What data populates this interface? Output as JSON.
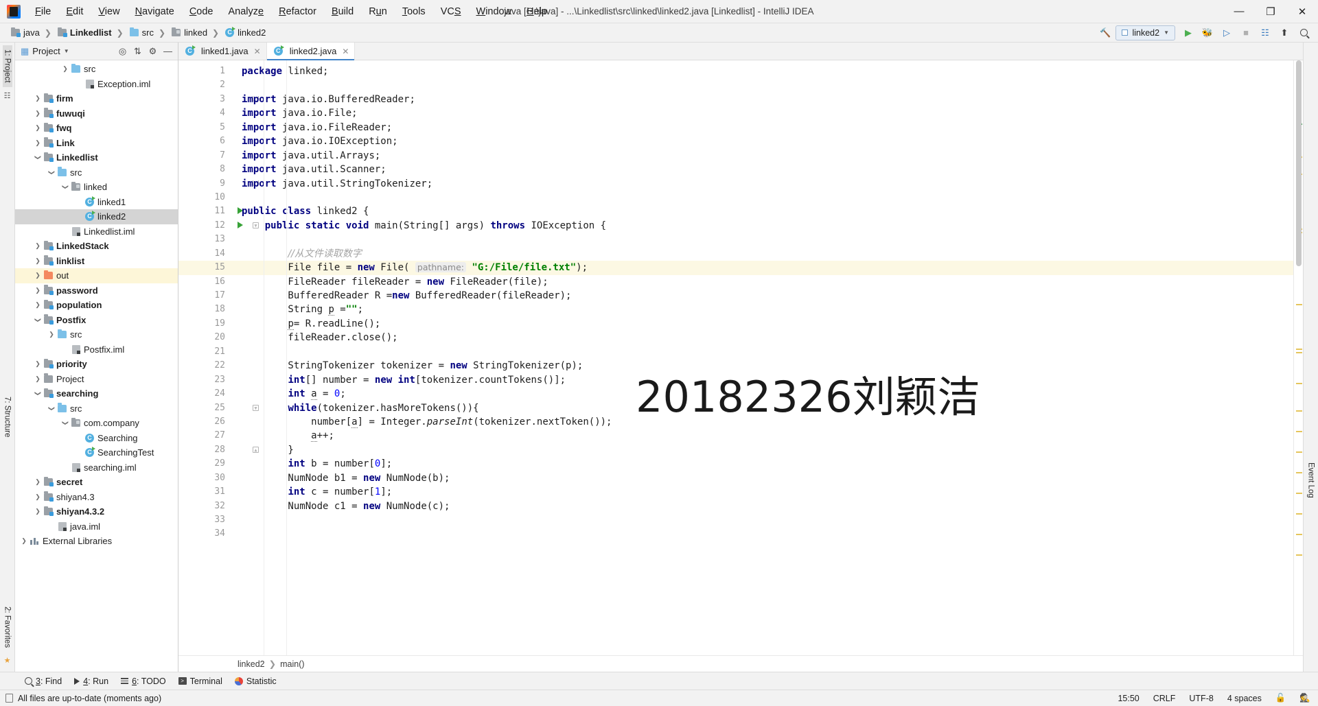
{
  "window": {
    "title": "java [G:\\java] - ...\\Linkedlist\\src\\linked\\linked2.java [Linkedlist] - IntelliJ IDEA",
    "minimize": "—",
    "maximize": "❐",
    "close": "✕"
  },
  "menubar": [
    {
      "label": "File"
    },
    {
      "label": "Edit"
    },
    {
      "label": "View"
    },
    {
      "label": "Navigate"
    },
    {
      "label": "Code"
    },
    {
      "label": "Analyze"
    },
    {
      "label": "Refactor"
    },
    {
      "label": "Build"
    },
    {
      "label": "Run"
    },
    {
      "label": "Tools"
    },
    {
      "label": "VCS"
    },
    {
      "label": "Window"
    },
    {
      "label": "Help"
    }
  ],
  "breadcrumbs": [
    {
      "label": "java",
      "icon": "folder-module-icon",
      "bold": false
    },
    {
      "label": "Linkedlist",
      "icon": "folder-module-icon",
      "bold": true
    },
    {
      "label": "src",
      "icon": "folder-source-icon",
      "bold": false
    },
    {
      "label": "linked",
      "icon": "folder-package-icon",
      "bold": false
    },
    {
      "label": "linked2",
      "icon": "java-class-icon",
      "bold": false
    }
  ],
  "toolbar_right": {
    "build_icon": "hammer-icon",
    "run_config": "linked2",
    "run_icon": "run-icon",
    "debug_icon": "debug-icon",
    "coverage_icon": "run-coverage-icon",
    "stop_icon": "stop-icon",
    "layout_icon": "layout-icon",
    "updates_icon": "updates-icon",
    "search_icon": "search-everywhere-icon"
  },
  "project_panel": {
    "title": "Project",
    "icons": [
      "target-icon",
      "collapse-all-icon",
      "settings-gear-icon",
      "hide-icon"
    ],
    "tree": [
      {
        "label": "src",
        "indent": 3,
        "arrow": "right",
        "icon": "folder-source-icon",
        "bold": false
      },
      {
        "label": "Exception.iml",
        "indent": 4,
        "arrow": "none",
        "icon": "iml-file-icon",
        "bold": false
      },
      {
        "label": "firm",
        "indent": 1,
        "arrow": "right",
        "icon": "folder-module-icon",
        "bold": true
      },
      {
        "label": "fuwuqi",
        "indent": 1,
        "arrow": "right",
        "icon": "folder-module-icon",
        "bold": true
      },
      {
        "label": "fwq",
        "indent": 1,
        "arrow": "right",
        "icon": "folder-module-icon",
        "bold": true
      },
      {
        "label": "Link",
        "indent": 1,
        "arrow": "right",
        "icon": "folder-module-icon",
        "bold": true
      },
      {
        "label": "Linkedlist",
        "indent": 1,
        "arrow": "down",
        "icon": "folder-module-icon",
        "bold": true
      },
      {
        "label": "src",
        "indent": 2,
        "arrow": "down",
        "icon": "folder-source-icon",
        "bold": false
      },
      {
        "label": "linked",
        "indent": 3,
        "arrow": "down",
        "icon": "folder-package-icon",
        "bold": false
      },
      {
        "label": "linked1",
        "indent": 4,
        "arrow": "none",
        "icon": "java-class-run-icon",
        "bold": false
      },
      {
        "label": "linked2",
        "indent": 4,
        "arrow": "none",
        "icon": "java-class-run-icon",
        "bold": false,
        "selected": true
      },
      {
        "label": "Linkedlist.iml",
        "indent": 3,
        "arrow": "none",
        "icon": "iml-file-icon",
        "bold": false
      },
      {
        "label": "LinkedStack",
        "indent": 1,
        "arrow": "right",
        "icon": "folder-module-icon",
        "bold": true
      },
      {
        "label": "linklist",
        "indent": 1,
        "arrow": "right",
        "icon": "folder-module-icon",
        "bold": true
      },
      {
        "label": "out",
        "indent": 1,
        "arrow": "right",
        "icon": "folder-excluded-icon",
        "bold": false,
        "highlight": true
      },
      {
        "label": "password",
        "indent": 1,
        "arrow": "right",
        "icon": "folder-module-icon",
        "bold": true
      },
      {
        "label": "population",
        "indent": 1,
        "arrow": "right",
        "icon": "folder-module-icon",
        "bold": true
      },
      {
        "label": "Postfix",
        "indent": 1,
        "arrow": "down",
        "icon": "folder-module-icon",
        "bold": true
      },
      {
        "label": "src",
        "indent": 2,
        "arrow": "right",
        "icon": "folder-source-icon",
        "bold": false
      },
      {
        "label": "Postfix.iml",
        "indent": 3,
        "arrow": "none",
        "icon": "iml-file-icon",
        "bold": false
      },
      {
        "label": "priority",
        "indent": 1,
        "arrow": "right",
        "icon": "folder-module-icon",
        "bold": true
      },
      {
        "label": "Project",
        "indent": 1,
        "arrow": "right",
        "icon": "folder-plain-icon",
        "bold": false
      },
      {
        "label": "searching",
        "indent": 1,
        "arrow": "down",
        "icon": "folder-module-icon",
        "bold": true
      },
      {
        "label": "src",
        "indent": 2,
        "arrow": "down",
        "icon": "folder-source-icon",
        "bold": false
      },
      {
        "label": "com.company",
        "indent": 3,
        "arrow": "down",
        "icon": "folder-package-icon",
        "bold": false
      },
      {
        "label": "Searching",
        "indent": 4,
        "arrow": "none",
        "icon": "java-class-icon",
        "bold": false
      },
      {
        "label": "SearchingTest",
        "indent": 4,
        "arrow": "none",
        "icon": "java-class-run-icon",
        "bold": false
      },
      {
        "label": "searching.iml",
        "indent": 3,
        "arrow": "none",
        "icon": "iml-file-icon",
        "bold": false
      },
      {
        "label": "secret",
        "indent": 1,
        "arrow": "right",
        "icon": "folder-module-icon",
        "bold": true
      },
      {
        "label": "shiyan4.3",
        "indent": 1,
        "arrow": "right",
        "icon": "folder-module-icon",
        "bold": false
      },
      {
        "label": "shiyan4.3.2",
        "indent": 1,
        "arrow": "right",
        "icon": "folder-module-icon",
        "bold": true
      },
      {
        "label": "java.iml",
        "indent": 2,
        "arrow": "none",
        "icon": "iml-file-icon",
        "bold": false
      },
      {
        "label": "External Libraries",
        "indent": 0,
        "arrow": "right",
        "icon": "library-icon",
        "bold": false
      }
    ]
  },
  "left_rail": {
    "project_label": "1: Project",
    "structure_label": "7: Structure",
    "favorites_label": "2: Favorites"
  },
  "right_rail": {
    "event_log_label": "Event Log"
  },
  "editor": {
    "tabs": [
      {
        "label": "linked1.java",
        "icon": "java-class-run-icon",
        "active": false
      },
      {
        "label": "linked2.java",
        "icon": "java-class-run-icon",
        "active": true
      }
    ],
    "watermark": "20182326刘颖洁",
    "breadcrumb": [
      "linked2",
      "main()"
    ],
    "lines": [
      {
        "n": 1,
        "run": false,
        "fold": "",
        "html": "<span class='kw'>package</span> linked;"
      },
      {
        "n": 2,
        "run": false,
        "fold": "",
        "html": ""
      },
      {
        "n": 3,
        "run": false,
        "fold": "top",
        "html": "<span class='kw'>import</span> java.io.BufferedReader;"
      },
      {
        "n": 4,
        "run": false,
        "fold": "",
        "html": "<span class='kw'>import</span> java.io.File;"
      },
      {
        "n": 5,
        "run": false,
        "fold": "",
        "html": "<span class='kw'>import</span> java.io.FileReader;"
      },
      {
        "n": 6,
        "run": false,
        "fold": "",
        "html": "<span class='kw'>import</span> java.io.IOException;"
      },
      {
        "n": 7,
        "run": false,
        "fold": "",
        "html": "<span class='kw'>import</span> java.util.Arrays;"
      },
      {
        "n": 8,
        "run": false,
        "fold": "",
        "html": "<span class='kw'>import</span> java.util.Scanner;"
      },
      {
        "n": 9,
        "run": false,
        "fold": "bottom",
        "html": "<span class='kw'>import</span> java.util.StringTokenizer;"
      },
      {
        "n": 10,
        "run": false,
        "fold": "",
        "html": ""
      },
      {
        "n": 11,
        "run": true,
        "fold": "",
        "html": "<span class='kw'>public class</span> linked2 {"
      },
      {
        "n": 12,
        "run": true,
        "fold": "open",
        "html": "    <span class='kw'>public static void</span> main(String[] args) <span class='kw'>throws</span> IOException {"
      },
      {
        "n": 13,
        "run": false,
        "fold": "",
        "html": ""
      },
      {
        "n": 14,
        "run": false,
        "fold": "",
        "html": "        <span class='cmt'>//从文件读取数字</span>"
      },
      {
        "n": 15,
        "run": false,
        "fold": "",
        "html": "        File file = <span class='kw'>new</span> File( <span class='hint'>pathname:</span> <span class='str'>\"G:/File/file.txt\"</span>);",
        "highlight": true
      },
      {
        "n": 16,
        "run": false,
        "fold": "",
        "html": "        FileReader fileReader = <span class='kw'>new</span> FileReader(file);"
      },
      {
        "n": 17,
        "run": false,
        "fold": "",
        "html": "        BufferedReader R =<span class='kw'>new</span> BufferedReader(fileReader);"
      },
      {
        "n": 18,
        "run": false,
        "fold": "",
        "html": "        String <span class='und'>p</span> =<span class='str'>\"\"</span>;"
      },
      {
        "n": 19,
        "run": false,
        "fold": "",
        "html": "        <span class='und'>p</span>= R.readLine();"
      },
      {
        "n": 20,
        "run": false,
        "fold": "",
        "html": "        fileReader.close();"
      },
      {
        "n": 21,
        "run": false,
        "fold": "",
        "html": ""
      },
      {
        "n": 22,
        "run": false,
        "fold": "",
        "html": "        StringTokenizer tokenizer = <span class='kw'>new</span> StringTokenizer(p);"
      },
      {
        "n": 23,
        "run": false,
        "fold": "",
        "html": "        <span class='kw'>int</span>[] number = <span class='kw'>new</span> <span class='kw'>int</span>[tokenizer.countTokens()];"
      },
      {
        "n": 24,
        "run": false,
        "fold": "",
        "html": "        <span class='kw'>int</span> <span class='und'>a</span> = <span class='num'>0</span>;"
      },
      {
        "n": 25,
        "run": false,
        "fold": "open",
        "html": "        <span class='kw'>while</span>(tokenizer.hasMoreTokens()){"
      },
      {
        "n": 26,
        "run": false,
        "fold": "",
        "html": "            number[<span class='und'>a</span>] = Integer.<span class='ital'>parseInt</span>(tokenizer.nextToken());"
      },
      {
        "n": 27,
        "run": false,
        "fold": "",
        "html": "            <span class='und'>a</span>++;"
      },
      {
        "n": 28,
        "run": false,
        "fold": "close",
        "html": "        }"
      },
      {
        "n": 29,
        "run": false,
        "fold": "",
        "html": "        <span class='kw'>int</span> b = number[<span class='num'>0</span>];"
      },
      {
        "n": 30,
        "run": false,
        "fold": "",
        "html": "        NumNode b1 = <span class='kw'>new</span> NumNode(b);"
      },
      {
        "n": 31,
        "run": false,
        "fold": "",
        "html": "        <span class='kw'>int</span> c = number[<span class='num'>1</span>];"
      },
      {
        "n": 32,
        "run": false,
        "fold": "",
        "html": "        NumNode c1 = <span class='kw'>new</span> NumNode(c);"
      },
      {
        "n": 33,
        "run": false,
        "fold": "",
        "html": ""
      },
      {
        "n": 34,
        "run": false,
        "fold": "",
        "html": ""
      }
    ]
  },
  "bottom_toolwindows": [
    {
      "label": "3: Find",
      "icon": "search-icon",
      "mnemonic": "3"
    },
    {
      "label": "4: Run",
      "icon": "run-icon",
      "mnemonic": "4"
    },
    {
      "label": "6: TODO",
      "icon": "todo-icon",
      "mnemonic": "6"
    },
    {
      "label": "Terminal",
      "icon": "terminal-icon",
      "mnemonic": ""
    },
    {
      "label": "Statistic",
      "icon": "statistic-icon",
      "mnemonic": ""
    }
  ],
  "statusbar": {
    "message": "All files are up-to-date (moments ago)",
    "time": "15:50",
    "line_separator": "CRLF",
    "encoding": "UTF-8",
    "indent": "4 spaces",
    "lock_icon": "unlocked-icon",
    "inspector_icon": "hector-icon"
  },
  "colors": {
    "accent": "#4083c9",
    "keyword": "#000080",
    "string": "#008000",
    "number": "#0000ff",
    "comment": "#a5a5a5",
    "highlight_line": "#fcf8e3",
    "selection": "#d4d4d4"
  }
}
